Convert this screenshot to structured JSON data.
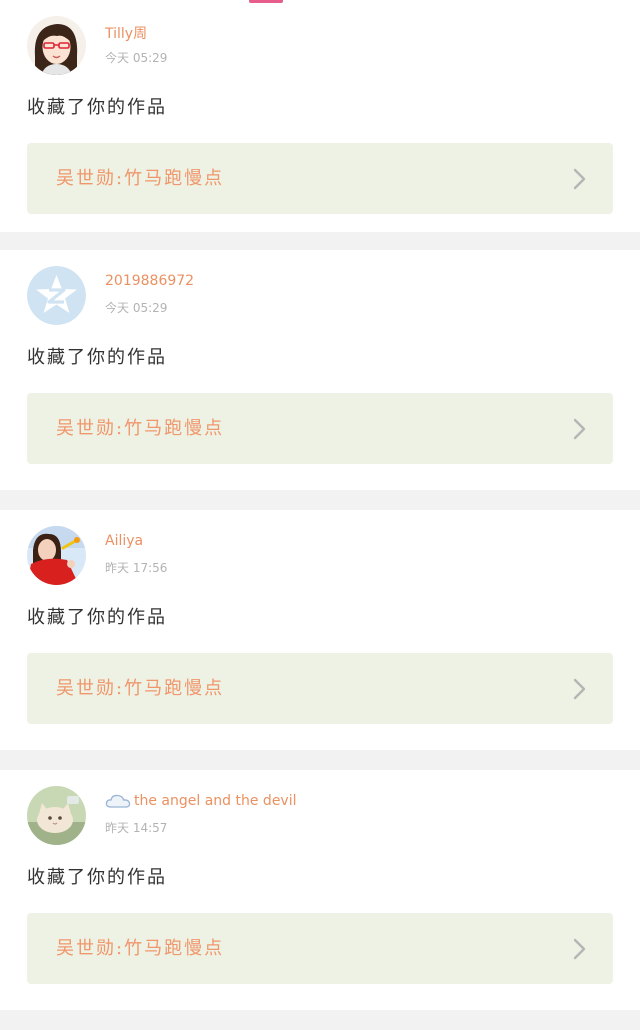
{
  "feed": {
    "items": [
      {
        "username": "Tilly周",
        "has_badge": false,
        "time": "今天 05:29",
        "action": "收藏了你的作品",
        "work_title": "吴世勋:竹马跑慢点",
        "avatar": "cartoon-girl-glasses-avatar"
      },
      {
        "username": "2019886972",
        "has_badge": false,
        "time": "今天 05:29",
        "action": "收藏了你的作品",
        "work_title": "吴世勋:竹马跑慢点",
        "avatar": "default-qq-avatar"
      },
      {
        "username": "Ailiya",
        "has_badge": false,
        "time": "昨天 17:56",
        "action": "收藏了你的作品",
        "work_title": "吴世勋:竹马跑慢点",
        "avatar": "photo-girl-red-avatar"
      },
      {
        "username": "the angel and the devil",
        "has_badge": true,
        "time": "昨天 14:57",
        "action": "收藏了你的作品",
        "work_title": "吴世勋:竹马跑慢点",
        "avatar": "photo-cat-avatar"
      }
    ]
  },
  "colors": {
    "username": "#eb9161",
    "work_title": "#f0966a",
    "link_bg": "#eef2e5",
    "tab_indicator": "#e65c8b",
    "separator": "#f2f2f2"
  }
}
